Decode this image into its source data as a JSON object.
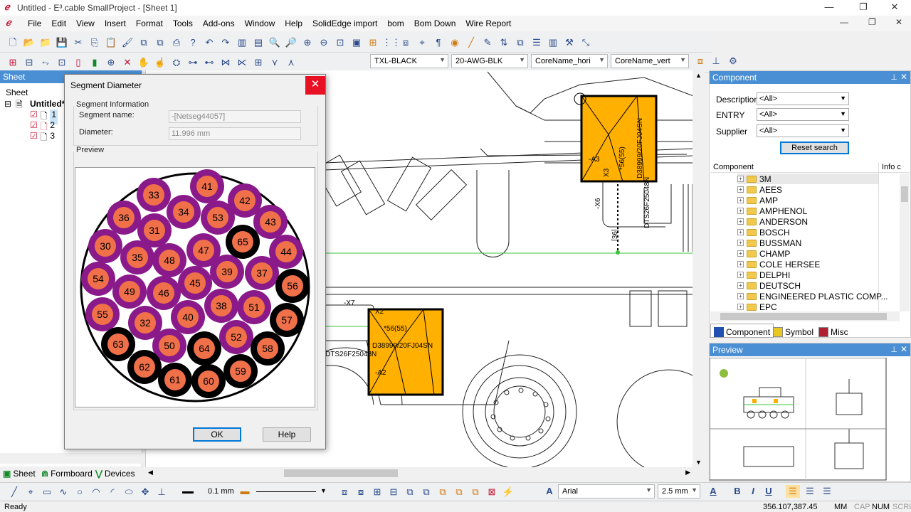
{
  "window": {
    "title": "Untitled - E³.cable SmallProject - [Sheet 1]",
    "app_icon": "ℯ"
  },
  "menubar": {
    "items": [
      "File",
      "Edit",
      "View",
      "Insert",
      "Format",
      "Tools",
      "Add-ons",
      "Window",
      "Help",
      "SolidEdge import",
      "bom",
      "Bom Down",
      "Wire Report"
    ]
  },
  "toolbar2": {
    "combos": [
      {
        "value": "TXL-BLACK"
      },
      {
        "value": "20-AWG-BLK"
      },
      {
        "value": "CoreName_hori"
      },
      {
        "value": "CoreName_vert"
      }
    ]
  },
  "sheet_panel": {
    "header": "Sheet",
    "root": "Sheet",
    "project": "Untitled*",
    "sheets": [
      "1",
      "2",
      "3"
    ],
    "tabs": [
      "Sheet",
      "Formboard",
      "Devices"
    ]
  },
  "component_panel": {
    "header": "Component",
    "filters": [
      {
        "label": "Description",
        "value": "<All>"
      },
      {
        "label": "ENTRY",
        "value": "<All>"
      },
      {
        "label": "Supplier",
        "value": "<All>"
      }
    ],
    "reset_label": "Reset search",
    "list_header": "Component",
    "list_header2": "Info c",
    "items": [
      "3M",
      "AEES",
      "AMP",
      "AMPHENOL",
      "ANDERSON",
      "BOSCH",
      "BUSSMAN",
      "CHAMP",
      "COLE HERSEE",
      "DELPHI",
      "DEUTSCH",
      "ENGINEERED PLASTIC COMP...",
      "EPC"
    ],
    "tabs": [
      "Component",
      "Symbol",
      "Misc"
    ]
  },
  "preview_panel": {
    "header": "Preview"
  },
  "dialog": {
    "title": "Segment Diameter",
    "group_label": "Segment Information",
    "segment_name_label": "Segment name:",
    "segment_name_value": "-[Netseg44057]",
    "diameter_label": "Diameter:",
    "diameter_value": "11.996 mm",
    "preview_label": "Preview",
    "ok_label": "OK",
    "help_label": "Help",
    "wires_purple": [
      "33",
      "41",
      "42",
      "36",
      "34",
      "53",
      "43",
      "31",
      "30",
      "47",
      "44",
      "35",
      "48",
      "39",
      "37",
      "54",
      "45",
      "49",
      "46",
      "38",
      "51",
      "55",
      "32",
      "40",
      "52",
      "50"
    ],
    "wires_black": [
      "65",
      "56",
      "57",
      "63",
      "64",
      "58",
      "62",
      "59",
      "61",
      "60"
    ]
  },
  "canvas": {
    "labels": {
      "a3": "-A3",
      "x3": "X3",
      "x6": "-X6",
      "pn1": "D38999/20FJ04SN",
      "pn2": "DTS26F25048N",
      "pn3": "*56(55)",
      "a2": "-A2",
      "x7": "-X7",
      "x2": "X2",
      "pn4": "*56(55)",
      "pn5": "D38999/20FJ04SN",
      "pn6": "DTS26F25048N",
      "n36": "[36]"
    }
  },
  "bottombar": {
    "line_width": "0.1 mm",
    "font": "Arial",
    "font_size": "2.5 mm"
  },
  "statusbar": {
    "left": "Ready",
    "coords": "356.107,387.45",
    "units": "MM",
    "cap": "CAP",
    "num": "NUM",
    "scrl": "SCRL"
  },
  "colors": {
    "accent": "#4a8fd4",
    "orange": "#ffb000",
    "purple": "#8a1a8a",
    "wire_core": "#f0704a"
  }
}
